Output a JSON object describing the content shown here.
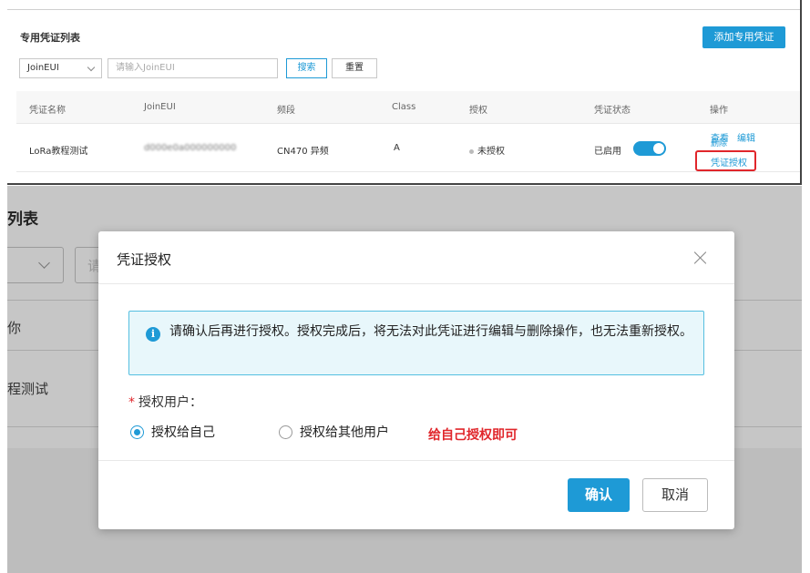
{
  "top": {
    "page_title": "专用凭证列表",
    "add_button": "添加专用凭证",
    "filter_select": "JoinEUI",
    "search_placeholder": "请输入JoinEUI",
    "search_button": "搜索",
    "reset_button": "重置",
    "columns": [
      "凭证名称",
      "JoinEUI",
      "频段",
      "Class",
      "授权",
      "凭证状态",
      "操作"
    ],
    "row": {
      "name": "LoRa教程测试",
      "joineui": "d000e0a000000000",
      "band": "CN470 异频",
      "class": "A",
      "auth": "未授权",
      "status": "已启用",
      "actions": {
        "view": "查看",
        "edit": "编辑",
        "delete": "删除",
        "authorize": "凭证授权"
      }
    },
    "highlight_color": "#e0262b"
  },
  "background": {
    "title_fragment": "列表",
    "input_fragment": "请",
    "header_fragment": "你",
    "row_fragment": "程测试"
  },
  "modal": {
    "title": "凭证授权",
    "alert_text": "请确认后再进行授权。授权完成后，将无法对此凭证进行编辑与删除操作，也无法重新授权。",
    "field_label": "授权用户：",
    "required_mark": "*",
    "option_self": "授权给自己",
    "option_other": "授权给其他用户",
    "selected": "self",
    "note": "给自己授权即可",
    "confirm_button": "确认",
    "cancel_button": "取消"
  },
  "colors": {
    "accent": "#1e9ad6",
    "danger": "#e0262b"
  }
}
